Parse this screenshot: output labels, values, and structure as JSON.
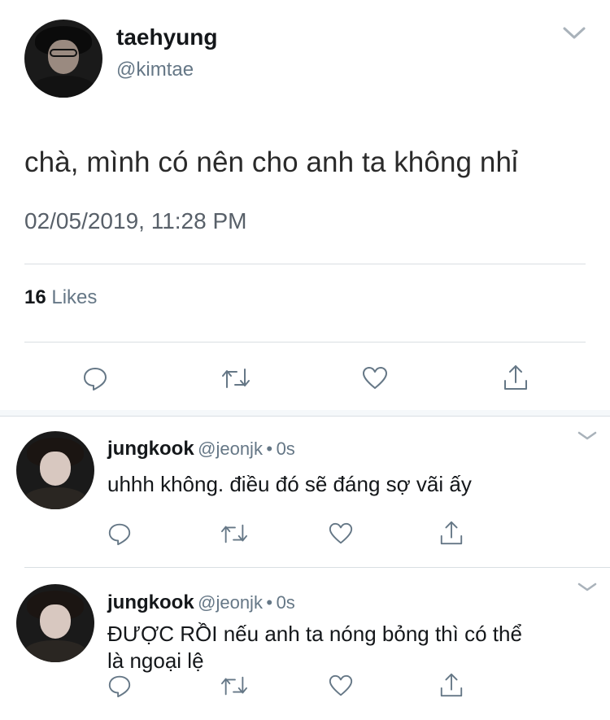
{
  "main_tweet": {
    "display_name": "taehyung",
    "handle": "@kimtae",
    "text": "chà, mình có nên cho anh ta không nhỉ",
    "timestamp": "02/05/2019, 11:28 PM",
    "likes_count": "16",
    "likes_label": "Likes",
    "icons": [
      "reply-icon",
      "retweet-icon",
      "like-icon",
      "share-icon",
      "chevron-down-icon"
    ]
  },
  "replies": [
    {
      "display_name": "jungkook",
      "handle": "@jeonjk",
      "separator": "•",
      "time": "0s",
      "text": "uhhh không. điều đó sẽ đáng sợ vãi ấy"
    },
    {
      "display_name": "jungkook",
      "handle": "@jeonjk",
      "separator": "•",
      "time": "0s",
      "text_line1": "ĐƯỢC RỒI nếu anh ta nóng bỏng thì có thể",
      "text_line2": "là ngoại lệ"
    }
  ],
  "colors": {
    "text": "#14171a",
    "secondary": "#657786",
    "divider": "#d9dfe3",
    "separator_band": "#f5f8fa"
  }
}
